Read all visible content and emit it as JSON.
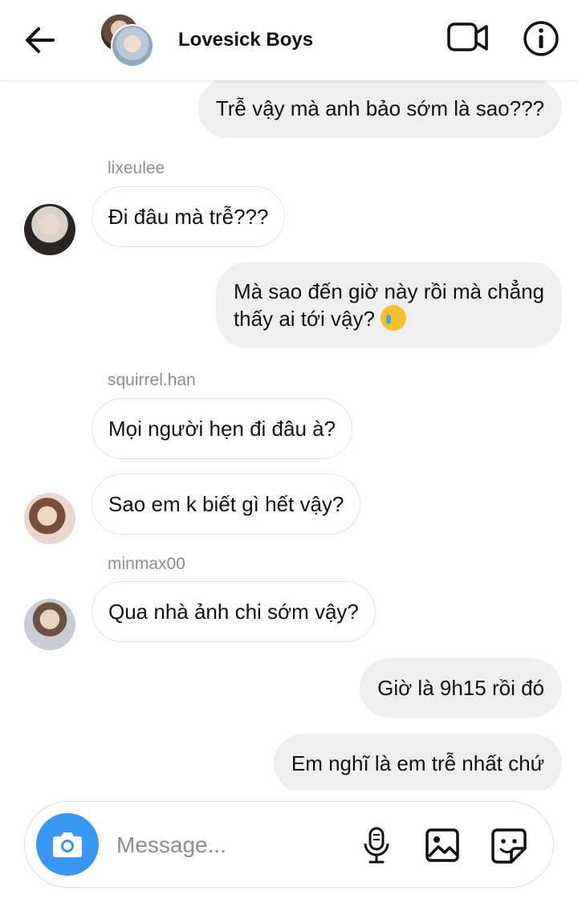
{
  "header": {
    "title": "Lovesick Boys",
    "icons": [
      "arrow-left-icon",
      "video-call-icon",
      "info-icon"
    ]
  },
  "messages": [
    {
      "direction": "out",
      "text": "Trễ vậy mà anh bảo sớm là sao???"
    },
    {
      "direction": "in",
      "sender": "lixeulee",
      "text": "Đi đâu mà trễ???"
    },
    {
      "direction": "out",
      "line1": "Mà sao đến giờ này rồi mà chẳng",
      "line2": "thấy ai tới vậy?",
      "emoji": "crying-face-emoji"
    },
    {
      "direction": "in",
      "sender": "squirrel.han",
      "text": "Mọi người hẹn đi đâu à?"
    },
    {
      "direction": "in",
      "text": "Sao em k biết gì hết vậy?"
    },
    {
      "direction": "in",
      "sender": "minmax00",
      "text": "Qua nhà ảnh chi sớm vậy?"
    },
    {
      "direction": "out",
      "text": "Giờ là 9h15 rồi đó"
    },
    {
      "direction": "out",
      "text": "Em nghĩ là em trễ nhất chứ"
    }
  ],
  "composer": {
    "placeholder": "Message...",
    "icons": [
      "camera-icon",
      "microphone-icon",
      "gallery-icon",
      "sticker-icon"
    ],
    "accent_color": "#3897f0"
  }
}
